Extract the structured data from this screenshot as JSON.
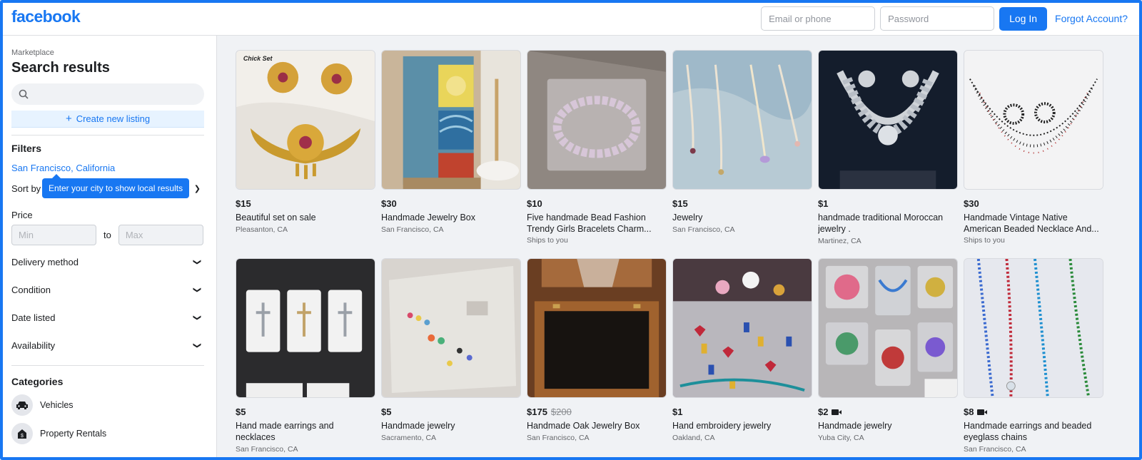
{
  "header": {
    "logo": "facebook",
    "email_placeholder": "Email or phone",
    "password_placeholder": "Password",
    "login_label": "Log In",
    "forgot_label": "Forgot Account?"
  },
  "sidebar": {
    "breadcrumb": "Marketplace",
    "title": "Search results",
    "search_placeholder": "",
    "create_listing": "Create new listing",
    "filters_title": "Filters",
    "location": "San Francisco, California",
    "sort_label": "Sort by",
    "tooltip": "Enter your city to show local results",
    "price_label": "Price",
    "min_placeholder": "Min",
    "to_label": "to",
    "max_placeholder": "Max",
    "filters": [
      "Delivery method",
      "Condition",
      "Date listed",
      "Availability"
    ],
    "categories_title": "Categories",
    "categories": [
      {
        "label": "Vehicles",
        "icon": "car-icon"
      },
      {
        "label": "Property Rentals",
        "icon": "house-icon"
      }
    ]
  },
  "listings": [
    {
      "price": "$15",
      "title": "Beautiful set on sale",
      "location": "Pleasanton, CA",
      "thumb_text": "Chick Set"
    },
    {
      "price": "$30",
      "title": "Handmade Jewelry Box",
      "location": "San Francisco, CA"
    },
    {
      "price": "$10",
      "title": "Five handmade Bead Fashion Trendy Girls Bracelets Charm...",
      "location": "",
      "shipping": "Ships to you"
    },
    {
      "price": "$15",
      "title": "Jewelry",
      "location": "San Francisco, CA"
    },
    {
      "price": "$1",
      "title": "handmade traditional Moroccan jewelry .",
      "location": "Martinez, CA"
    },
    {
      "price": "$30",
      "title": "Handmade Vintage Native American Beaded Necklace And...",
      "location": "",
      "shipping": "Ships to you"
    },
    {
      "price": "$5",
      "title": "Hand made earrings and necklaces",
      "location": "San Francisco, CA"
    },
    {
      "price": "$5",
      "title": "Handmade jewelry",
      "location": "Sacramento, CA"
    },
    {
      "price": "$175",
      "old_price": "$200",
      "title": "Handmade Oak Jewelry Box",
      "location": "San Francisco, CA"
    },
    {
      "price": "$1",
      "title": "Hand embroidery jewelry",
      "location": "Oakland, CA"
    },
    {
      "price": "$2",
      "video": true,
      "title": "Handmade jewelry",
      "location": "Yuba City, CA"
    },
    {
      "price": "$8",
      "video": true,
      "title": "Handmade earrings and beaded eyeglass chains",
      "location": "San Francisco, CA"
    }
  ],
  "colors": {
    "accent": "#1877f2",
    "background": "#f0f2f5"
  }
}
